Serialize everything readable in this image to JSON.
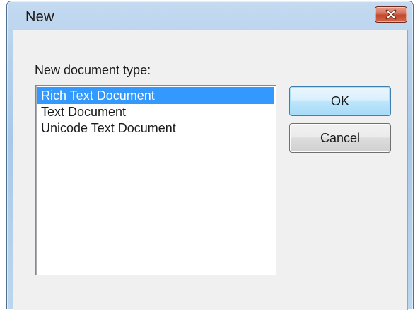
{
  "window": {
    "title": "New",
    "accent_color": "#b6d1ed",
    "close_icon": "close-icon"
  },
  "dialog": {
    "prompt": "New document type:",
    "document_types": [
      "Rich Text Document",
      "Text Document",
      "Unicode Text Document"
    ],
    "selected_index": 0,
    "selection_color": "#3399ff"
  },
  "buttons": {
    "ok_label": "OK",
    "cancel_label": "Cancel"
  }
}
